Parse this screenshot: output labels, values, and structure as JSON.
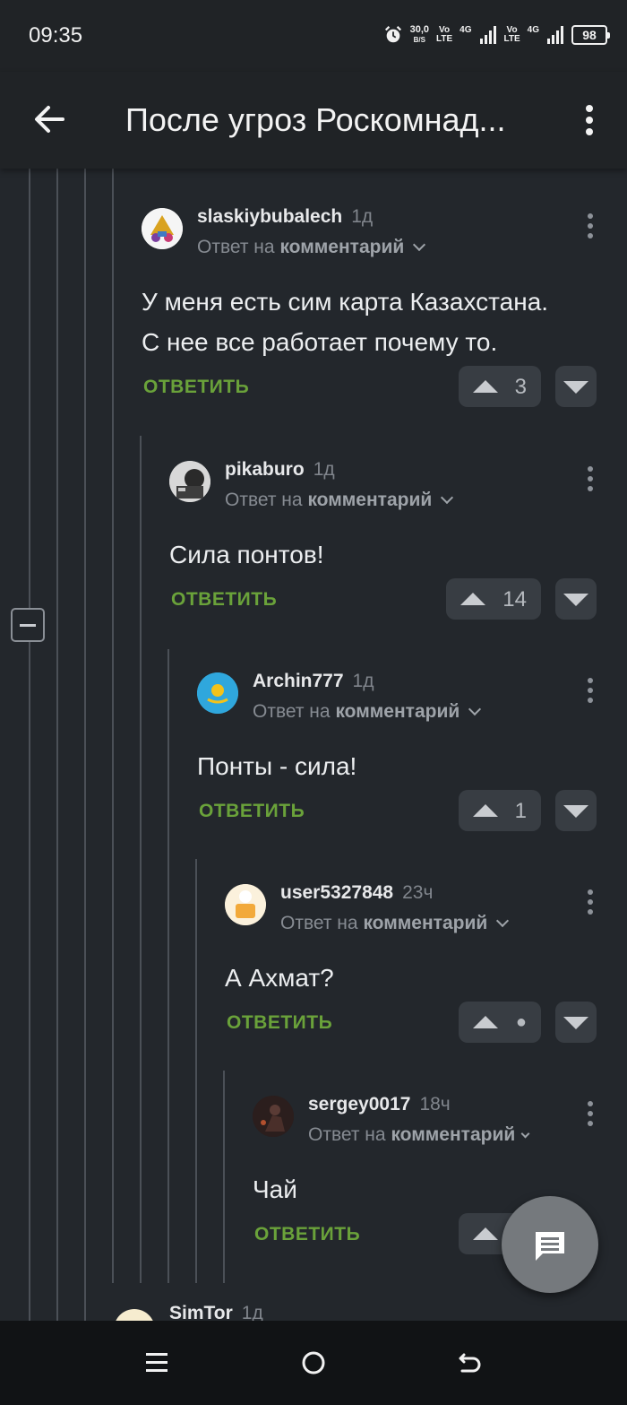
{
  "status_bar": {
    "time": "09:35",
    "speed_value": "30,0",
    "speed_unit": "B/S",
    "sim1_label_top": "Vo",
    "sim1_label_bottom": "LTE",
    "sim1_network": "4G",
    "sim2_label_top": "Vo",
    "sim2_label_bottom": "LTE",
    "sim2_network": "4G",
    "battery": "98"
  },
  "header": {
    "title": "После угроз Роскомнад..."
  },
  "comments": [
    {
      "user": "slaskiybubalech",
      "time": "1д",
      "reply_prefix": "Ответ на",
      "reply_target": "комментарий",
      "text_lines": [
        "У меня есть сим карта Казахстана.",
        "С нее все работает почему то."
      ],
      "answer": "ОТВЕТИТЬ",
      "votes": "3"
    },
    {
      "user": "pikaburo",
      "time": "1д",
      "reply_prefix": "Ответ на",
      "reply_target": "комментарий",
      "text_lines": [
        "Сила понтов!"
      ],
      "answer": "ОТВЕТИТЬ",
      "votes": "14"
    },
    {
      "user": "Archin777",
      "time": "1д",
      "reply_prefix": "Ответ на",
      "reply_target": "комментарий",
      "text_lines": [
        "Понты - сила!"
      ],
      "answer": "ОТВЕТИТЬ",
      "votes": "1"
    },
    {
      "user": "user5327848",
      "time": "23ч",
      "reply_prefix": "Ответ на",
      "reply_target": "комментарий",
      "text_lines": [
        "А Ахмат?"
      ],
      "answer": "ОТВЕТИТЬ",
      "votes": "●"
    },
    {
      "user": "sergey0017",
      "time": "18ч",
      "reply_prefix": "Ответ на",
      "reply_target": "комментарий",
      "text_lines": [
        "Чай"
      ],
      "answer": "ОТВЕТИТЬ"
    },
    {
      "user": "SimTor",
      "time": "1д"
    }
  ],
  "colors": {
    "background": "#23272c",
    "header": "#202326",
    "accent_green": "#6aa23a",
    "vote_bg": "#383d43"
  },
  "icons": {
    "back": "arrow-left-icon",
    "menu": "more-vertical-icon",
    "fab": "comment-icon",
    "nav_menu": "menu-icon",
    "nav_home": "home-circle-icon",
    "nav_back": "return-icon"
  }
}
